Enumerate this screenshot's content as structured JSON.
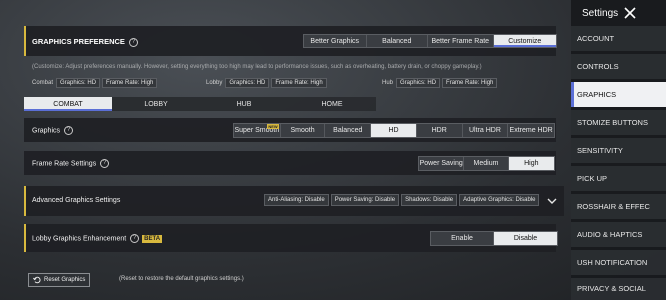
{
  "graphics_preference": {
    "title": "GRAPHICS PREFERENCE",
    "options": [
      "Better Graphics",
      "Balanced",
      "Better Frame Rate",
      "Customize"
    ],
    "selected": 3,
    "note": "(Customize: Adjust preferences manually. However, setting everything too high may lead to performance issues, such as overheating, battery drain, or choppy gameplay.)"
  },
  "summary": [
    {
      "label": "Combat",
      "graphics": "Graphics: HD",
      "framerate": "Frame Rate: High"
    },
    {
      "label": "Lobby",
      "graphics": "Graphics: HD",
      "framerate": "Frame Rate: High"
    },
    {
      "label": "Hub",
      "graphics": "Graphics: HD",
      "framerate": "Frame Rate: High"
    }
  ],
  "mode_tabs": [
    "COMBAT",
    "LOBBY",
    "HUB",
    "HOME"
  ],
  "mode_tab_selected": 0,
  "graphics": {
    "label": "Graphics",
    "options": [
      "Super Smooth",
      "Smooth",
      "Balanced",
      "HD",
      "HDR",
      "Ultra HDR",
      "Extreme HDR"
    ],
    "selected": 3,
    "badge": "NEW"
  },
  "frame_rate": {
    "label": "Frame Rate Settings",
    "options": [
      "Power Saving",
      "Medium",
      "High"
    ],
    "selected": 2
  },
  "advanced": {
    "label": "Advanced Graphics Settings",
    "chips": [
      "Anti-Aliasing: Disable",
      "Power Saving: Disable",
      "Shadows: Disable",
      "Adaptive Graphics: Disable"
    ]
  },
  "lobby_enhancement": {
    "label": "Lobby Graphics Enhancement",
    "beta": "BETA",
    "options": [
      "Enable",
      "Disable"
    ],
    "selected": 1
  },
  "reset": {
    "button": "Reset Graphics",
    "note": "(Reset to restore the default graphics settings.)"
  },
  "sidebar": {
    "title": "Settings",
    "items": [
      "ACCOUNT",
      "CONTROLS",
      "GRAPHICS",
      "STOMIZE BUTTONS",
      "SENSITIVITY",
      "PICK UP",
      "ROSSHAIR & EFFEC",
      "AUDIO & HAPTICS",
      "USH NOTIFICATION",
      "PRIVACY & SOCIAL"
    ],
    "selected": 2
  },
  "colors": {
    "accent": "#d8b93e",
    "selection_underline": "#5b6fd6",
    "selected_bg": "#e9ebed"
  }
}
